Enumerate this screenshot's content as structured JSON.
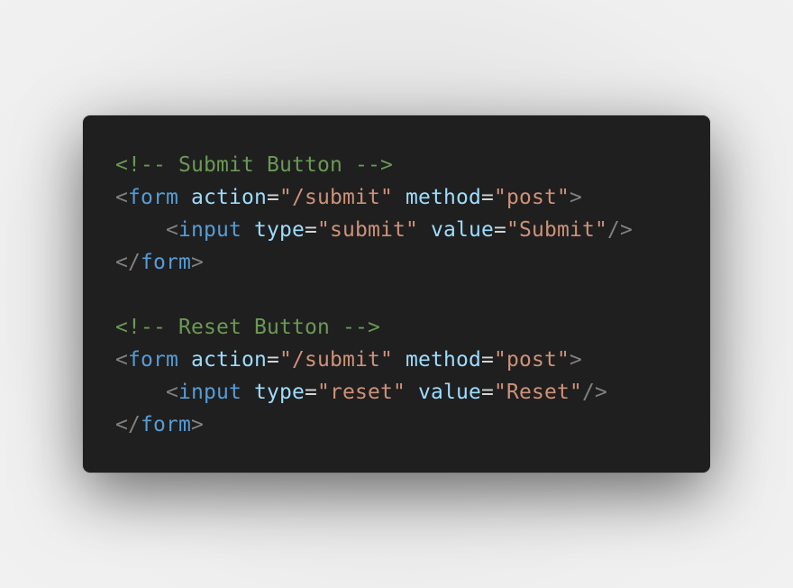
{
  "colors": {
    "background": "#1f1f1f",
    "comment": "#6a9955",
    "punctuation": "#808080",
    "tag": "#569cd6",
    "attribute": "#9cdcfe",
    "equals": "#d4d4d4",
    "string": "#ce9178"
  },
  "code": {
    "lines": [
      [
        {
          "t": "comment",
          "v": "<!-- Submit Button -->"
        }
      ],
      [
        {
          "t": "punct",
          "v": "<"
        },
        {
          "t": "tag",
          "v": "form"
        },
        {
          "t": "plain",
          "v": " "
        },
        {
          "t": "attr",
          "v": "action"
        },
        {
          "t": "eq",
          "v": "="
        },
        {
          "t": "string",
          "v": "\"/submit\""
        },
        {
          "t": "plain",
          "v": " "
        },
        {
          "t": "attr",
          "v": "method"
        },
        {
          "t": "eq",
          "v": "="
        },
        {
          "t": "string",
          "v": "\"post\""
        },
        {
          "t": "punct",
          "v": ">"
        }
      ],
      [
        {
          "t": "plain",
          "v": "    "
        },
        {
          "t": "punct",
          "v": "<"
        },
        {
          "t": "tag",
          "v": "input"
        },
        {
          "t": "plain",
          "v": " "
        },
        {
          "t": "attr",
          "v": "type"
        },
        {
          "t": "eq",
          "v": "="
        },
        {
          "t": "string",
          "v": "\"submit\""
        },
        {
          "t": "plain",
          "v": " "
        },
        {
          "t": "attr",
          "v": "value"
        },
        {
          "t": "eq",
          "v": "="
        },
        {
          "t": "string",
          "v": "\"Submit\""
        },
        {
          "t": "punct",
          "v": "/>"
        }
      ],
      [
        {
          "t": "punct",
          "v": "</"
        },
        {
          "t": "tag",
          "v": "form"
        },
        {
          "t": "punct",
          "v": ">"
        }
      ],
      [],
      [
        {
          "t": "comment",
          "v": "<!-- Reset Button -->"
        }
      ],
      [
        {
          "t": "punct",
          "v": "<"
        },
        {
          "t": "tag",
          "v": "form"
        },
        {
          "t": "plain",
          "v": " "
        },
        {
          "t": "attr",
          "v": "action"
        },
        {
          "t": "eq",
          "v": "="
        },
        {
          "t": "string",
          "v": "\"/submit\""
        },
        {
          "t": "plain",
          "v": " "
        },
        {
          "t": "attr",
          "v": "method"
        },
        {
          "t": "eq",
          "v": "="
        },
        {
          "t": "string",
          "v": "\"post\""
        },
        {
          "t": "punct",
          "v": ">"
        }
      ],
      [
        {
          "t": "plain",
          "v": "    "
        },
        {
          "t": "punct",
          "v": "<"
        },
        {
          "t": "tag",
          "v": "input"
        },
        {
          "t": "plain",
          "v": " "
        },
        {
          "t": "attr",
          "v": "type"
        },
        {
          "t": "eq",
          "v": "="
        },
        {
          "t": "string",
          "v": "\"reset\""
        },
        {
          "t": "plain",
          "v": " "
        },
        {
          "t": "attr",
          "v": "value"
        },
        {
          "t": "eq",
          "v": "="
        },
        {
          "t": "string",
          "v": "\"Reset\""
        },
        {
          "t": "punct",
          "v": "/>"
        }
      ],
      [
        {
          "t": "punct",
          "v": "</"
        },
        {
          "t": "tag",
          "v": "form"
        },
        {
          "t": "punct",
          "v": ">"
        }
      ]
    ]
  }
}
